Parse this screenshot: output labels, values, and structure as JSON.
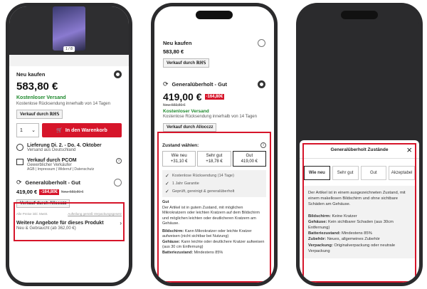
{
  "phone1": {
    "image_counter": "1 / 8",
    "new_buy": {
      "label": "Neu kaufen",
      "price": "583,80 €",
      "shipping": "Kostenloser Versand",
      "returns": "Kostenlose Rücksendung innerhalb von 14 Tagen",
      "seller": "Verkauf durch ℝℍ𝕊"
    },
    "quantity": "1",
    "cart_button": "In den Warenkorb",
    "delivery": {
      "title": "Lieferung Di. 2. - Do. 4. Oktober",
      "sub": "Versand aus Deutschland"
    },
    "seller_info": {
      "title": "Verkauf durch PCOM",
      "sub": "Gewerblicher Verkäufer",
      "links": "AGB | Impressum | Widerruf | Datenschutz"
    },
    "refurb": {
      "label": "Generalüberholt - Gut",
      "price": "419,00 €",
      "badge": "-164,80€",
      "old": "Neu: 583,80 €",
      "seller": "Verkauf durch Allocczz"
    },
    "footnote_left": "Alle Preise inkl. MwSt.",
    "footnote_right": "Aufteilung gemäß Verpackungsgesetz",
    "more": {
      "title": "Weitere Angebote für dieses Produkt",
      "sub": "Neu & Gebraucht (ab 362,00 €)"
    }
  },
  "phone2": {
    "new_buy": {
      "label": "Neu kaufen",
      "price": "583,80 €",
      "seller": "Verkauf durch ℝℍ𝕊"
    },
    "refurb": {
      "label": "Generalüberholt - Gut",
      "price": "419,00 €",
      "badge": "-164,80€",
      "old": "Neu: 583,80 €",
      "shipping": "Kostenloser Versand",
      "returns": "Kostenlose Rücksendung innerhalb von 14 Tagen",
      "seller": "Verkauf durch Allocczz"
    },
    "condition_title": "Zustand wählen:",
    "conditions": [
      {
        "name": "Wie neu",
        "price": "+31,10 €"
      },
      {
        "name": "Sehr gut",
        "price": "+18,78 €"
      },
      {
        "name": "Gut",
        "price": "419,00 €"
      }
    ],
    "benefits": [
      "Kostenlose Rücksendung (14 Tage)",
      "1 Jahr Garantie",
      "Geprüft, gereinigt & generalüberholt"
    ],
    "detail_title": "Gut",
    "detail_text": "Der Artikel ist in gutem Zustand, mit möglichen Mikrokratzern oder leichten Kratzern auf dem Bildschirm und möglichen leichten oder deutlicheren Kratzern am Gehäuse.",
    "specs": [
      {
        "k": "Bildschirm:",
        "v": " Kann Mikrokratzer oder leichte Kratzer aufweisen (nicht sichtbar bei Nutzung)"
      },
      {
        "k": "Gehäuse:",
        "v": " Kann leichte oder deutlichere Kratzer aufweisen (aus 30 cm Entfernung)"
      },
      {
        "k": "Batteriezustand:",
        "v": " Mindestens 85%"
      }
    ]
  },
  "phone3": {
    "modal_title": "Generalüberholt Zustände",
    "tabs": [
      "Wie neu",
      "Sehr gut",
      "Gut",
      "Akzeptabel"
    ],
    "intro": "Der Artikel ist in einem ausgezeichneten Zustand, mit einem makellosen Bildschirm und ohne sichtbare Schäden am Gehäuse.",
    "specs": [
      {
        "k": "Bildschirm:",
        "v": " Keine Kratzer"
      },
      {
        "k": "Gehäuse:",
        "v": " Kein sichtbarer Schaden (aus 30cm Entfernung)"
      },
      {
        "k": "Batteriezustand:",
        "v": " Mindestens 85%"
      },
      {
        "k": "Zubehör:",
        "v": " Neues, allgemeines Zubehör"
      },
      {
        "k": "Verpackung:",
        "v": " Originalverpackung oder neutrale Verpackung"
      }
    ]
  },
  "colors": {
    "accent": "#d6152a",
    "green": "#1f8a2e"
  }
}
